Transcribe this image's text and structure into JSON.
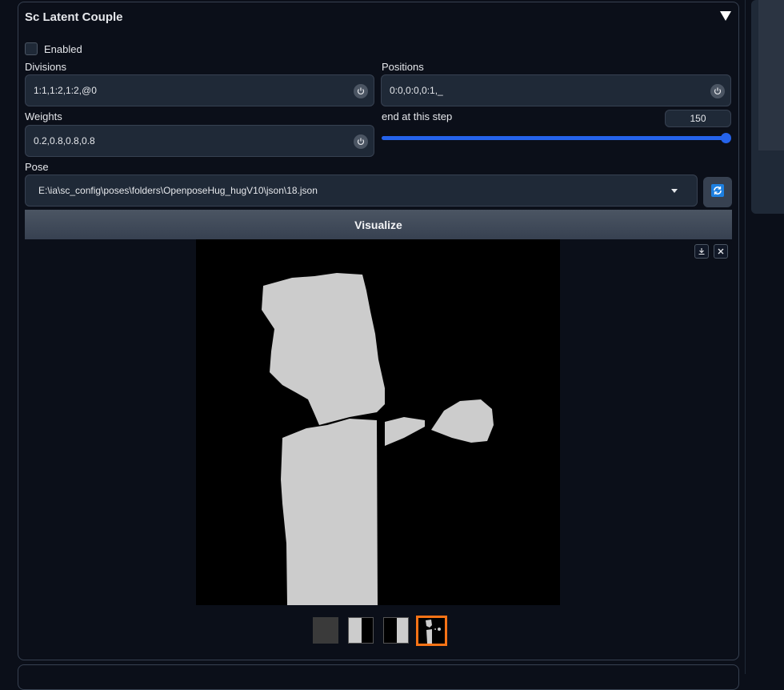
{
  "panel": {
    "title": "Sc Latent Couple",
    "enabled_label": "Enabled",
    "enabled": false
  },
  "divisions": {
    "label": "Divisions",
    "value": "1:1,1:2,1:2,@0"
  },
  "positions": {
    "label": "Positions",
    "value": "0:0,0:0,0:1,_"
  },
  "weights": {
    "label": "Weights",
    "value": "0.2,0.8,0.8,0.8"
  },
  "end_step": {
    "label": "end at this step",
    "value": "150",
    "fill": 1.0
  },
  "pose": {
    "label": "Pose",
    "value": "E:\\ia\\sc_config\\poses\\folders\\OpenposeHug_hugV10\\json\\18.json"
  },
  "visualize_label": "Visualize",
  "icons": {
    "collapse": "triangle-down-icon",
    "reset": "power-icon",
    "dropdown": "chevron-down-icon",
    "refresh": "refresh-icon",
    "download": "download-icon",
    "close": "close-icon"
  },
  "gallery": {
    "thumbnails": [
      "gray-mask",
      "left-half-mask",
      "right-half-mask",
      "pose-mask"
    ],
    "selected_index": 3
  },
  "colors": {
    "background": "#0b0f19",
    "accent": "#2563eb",
    "selected_border": "#f97316",
    "mask": "#cccccc"
  }
}
